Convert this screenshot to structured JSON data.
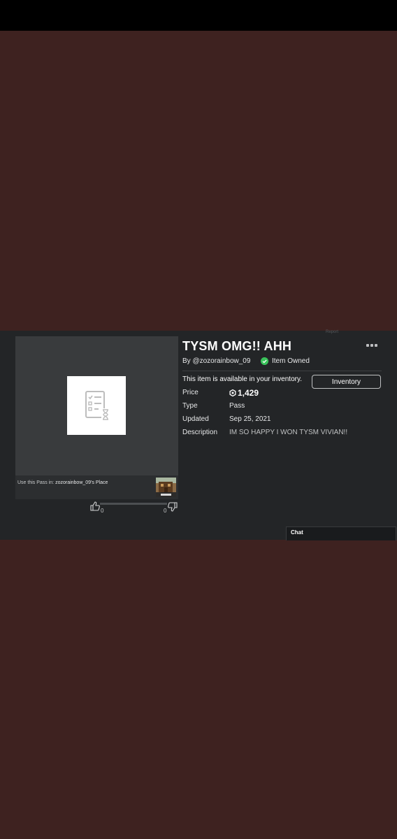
{
  "item": {
    "title": "TYSM OMG!! AHH",
    "byline": "By @zozorainbow_09",
    "owned_label": "Item Owned",
    "availability": "This item is available in your inventory.",
    "inventory_button": "Inventory",
    "details": {
      "price_label": "Price",
      "price_value": "1,429",
      "type_label": "Type",
      "type_value": "Pass",
      "updated_label": "Updated",
      "updated_value": "Sep 25, 2021",
      "description_label": "Description",
      "description_value": "IM SO HAPPY I WON TYSM VIVIAN!!"
    }
  },
  "thumbnail": {
    "use_prefix": "Use this Pass in: ",
    "place_name": "zozorainbow_09's Place",
    "place_icon": "game-thumbnail",
    "placeholder_icon": "pass-placeholder-icon"
  },
  "votes": {
    "up_count": "0",
    "down_count": "0"
  },
  "chat": {
    "label": "Chat"
  },
  "faint": {
    "report": "Report"
  },
  "colors": {
    "background": "#3e2220",
    "panel": "#232527",
    "owned_check": "#39c25a"
  }
}
